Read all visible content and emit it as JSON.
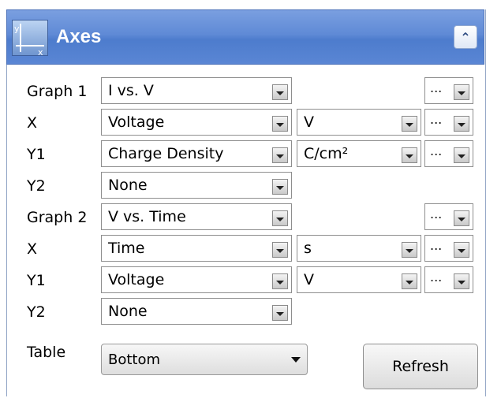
{
  "panel": {
    "title": "Axes"
  },
  "graph1": {
    "label": "Graph 1",
    "value": "I vs. V",
    "x": {
      "label": "X",
      "value": "Voltage",
      "unit": "V"
    },
    "y1": {
      "label": "Y1",
      "value": "Charge Density",
      "unit": "C/cm²"
    },
    "y2": {
      "label": "Y2",
      "value": "None"
    }
  },
  "graph2": {
    "label": "Graph 2",
    "value": "V vs. Time",
    "x": {
      "label": "X",
      "value": "Time",
      "unit": "s"
    },
    "y1": {
      "label": "Y1",
      "value": "Voltage",
      "unit": "V"
    },
    "y2": {
      "label": "Y2",
      "value": "None"
    }
  },
  "more_label": "...",
  "table": {
    "label": "Table",
    "value": "Bottom"
  },
  "refresh_label": "Refresh"
}
